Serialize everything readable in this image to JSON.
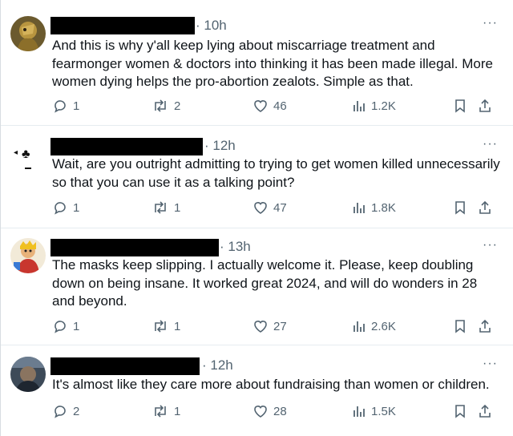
{
  "tweets": [
    {
      "time": "· 10h",
      "text": "And this is why y'all keep lying about miscarriage treatment and fearmonger women & doctors into thinking it has been made illegal.  More women dying helps the pro-abortion zealots.  Simple as that.",
      "replies": "1",
      "reposts": "2",
      "likes": "46",
      "views": "1.2K"
    },
    {
      "time": "· 12h",
      "text": "Wait, are you outright admitting to trying to get women killed unnecessarily so that you can use it as a talking point?",
      "replies": "1",
      "reposts": "1",
      "likes": "47",
      "views": "1.8K"
    },
    {
      "time": "· 13h",
      "text": "The masks keep slipping. I actually welcome it. Please, keep doubling down on being insane. It worked great 2024, and will do wonders in 28 and beyond.",
      "replies": "1",
      "reposts": "1",
      "likes": "27",
      "views": "2.6K"
    },
    {
      "time": "· 12h",
      "text": "It's almost like they care more about fundraising than women or children.",
      "replies": "2",
      "reposts": "1",
      "likes": "28",
      "views": "1.5K"
    }
  ],
  "more_label": "···",
  "icons": {
    "reply": "reply-icon",
    "repost": "repost-icon",
    "like": "heart-icon",
    "views": "views-icon",
    "bookmark": "bookmark-icon",
    "share": "share-icon"
  },
  "colors": {
    "text": "#0f1419",
    "secondary": "#536471",
    "redaction": "#000000"
  }
}
